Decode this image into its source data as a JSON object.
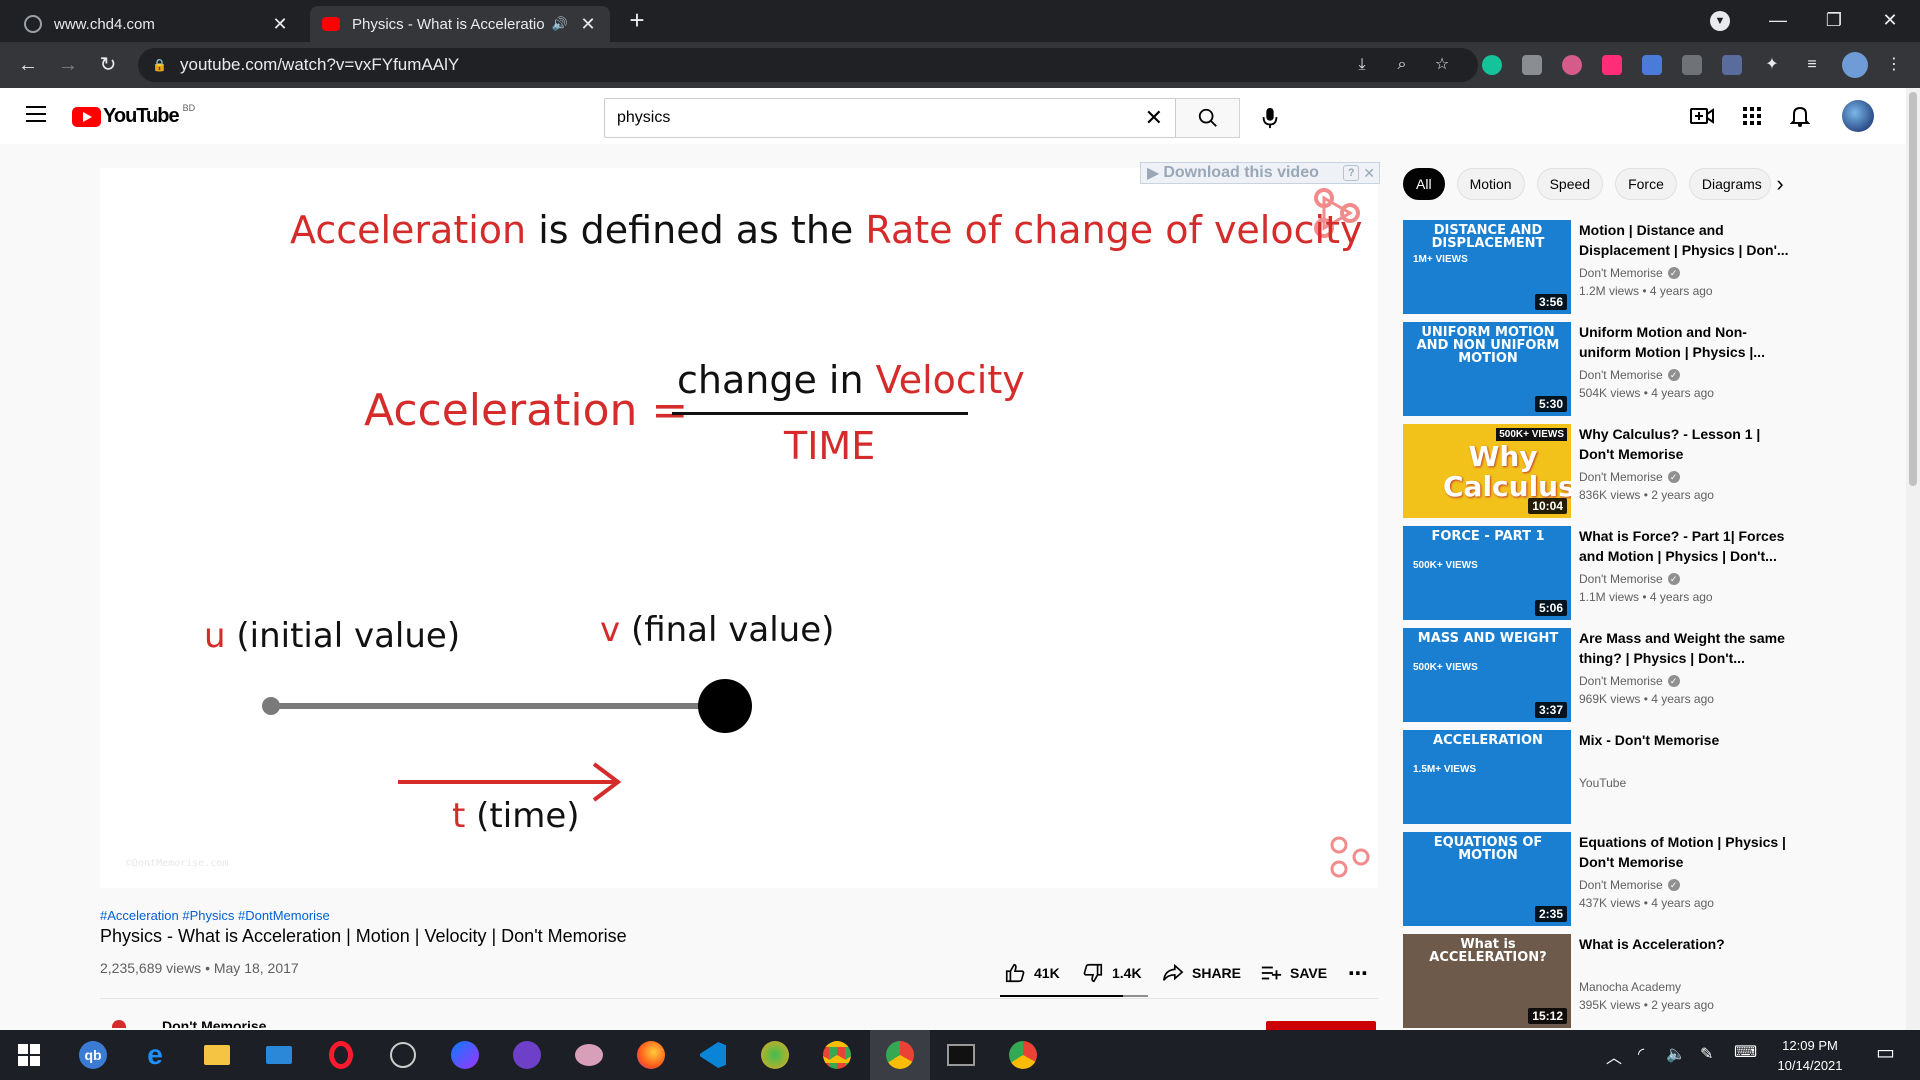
{
  "browser": {
    "tabs": [
      {
        "title": "www.chd4.com",
        "active": false
      },
      {
        "title": "Physics - What is Acceleratio",
        "active": true
      }
    ],
    "url": "youtube.com/watch?v=vxFYfumAAlY"
  },
  "youtube": {
    "logo_text": "YouTube",
    "country_code": "BD",
    "search_value": "physics"
  },
  "video": {
    "download_label": "Download this video",
    "download_help": "?",
    "slide": {
      "line1_red_a": "Acceleration",
      "line1_black": "is defined as the",
      "line1_red_b": "Rate of change of velocity",
      "formula_lhs": "Acceleration =",
      "numerator_black": "change in",
      "numerator_red": "Velocity",
      "denominator": "TIME",
      "u_letter": "u",
      "u_label": "(initial value)",
      "v_letter": "v",
      "v_label": "(final value)",
      "t_letter": "t",
      "t_label": "(time)",
      "watermark": "©DontMemorise.com"
    },
    "hashtags": "#Acceleration #Physics #DontMemorise",
    "title": "Physics - What is Acceleration | Motion | Velocity | Don't Memorise",
    "meta": "2,235,689 views • May 18, 2017",
    "likes": "41K",
    "dislikes": "1.4K",
    "like_ratio": 0.83,
    "share_label": "SHARE",
    "save_label": "SAVE",
    "more_label": "⋯",
    "channel_peek": "Don't Memorise"
  },
  "chips": [
    "All",
    "Motion",
    "Speed",
    "Force",
    "Diagrams"
  ],
  "recommendations": [
    {
      "thumb_title": "DISTANCE AND DISPLACEMENT",
      "thumb_views": "1M+ VIEWS",
      "duration": "3:56",
      "title": "Motion | Distance and Displacement | Physics | Don'...",
      "channel": "Don't Memorise",
      "verified": true,
      "meta": "1.2M views • 4 years ago",
      "color": "#1a7fd1"
    },
    {
      "thumb_title": "UNIFORM MOTION AND NON UNIFORM MOTION",
      "thumb_views": "",
      "duration": "5:30",
      "title": "Uniform Motion and Non-uniform Motion | Physics |...",
      "channel": "Don't Memorise",
      "verified": true,
      "meta": "504K views • 4 years ago",
      "color": "#1a7fd1"
    },
    {
      "thumb_title": "Why Calculus?",
      "thumb_views": "500K+ VIEWS",
      "duration": "10:04",
      "title": "Why Calculus? - Lesson 1 | Don't Memorise",
      "channel": "Don't Memorise",
      "verified": true,
      "meta": "836K views • 2 years ago",
      "color": "#f2c21b"
    },
    {
      "thumb_title": "FORCE - PART 1",
      "thumb_views": "500K+ VIEWS",
      "duration": "5:06",
      "title": "What is Force? - Part 1| Forces and Motion | Physics | Don't...",
      "channel": "Don't Memorise",
      "verified": true,
      "meta": "1.1M views • 4 years ago",
      "color": "#1a7fd1"
    },
    {
      "thumb_title": "MASS AND WEIGHT",
      "thumb_views": "500K+ VIEWS",
      "duration": "3:37",
      "title": "Are Mass and Weight the same thing? | Physics | Don't...",
      "channel": "Don't Memorise",
      "verified": true,
      "meta": "969K views • 4 years ago",
      "color": "#1a7fd1"
    },
    {
      "thumb_title": "ACCELERATION",
      "thumb_views": "1.5M+ VIEWS",
      "duration": "",
      "title": "Mix - Don't Memorise",
      "channel": "YouTube",
      "verified": false,
      "meta": "",
      "color": "#1a7fd1"
    },
    {
      "thumb_title": "EQUATIONS OF MOTION",
      "thumb_views": "",
      "duration": "2:35",
      "title": "Equations of Motion | Physics | Don't Memorise",
      "channel": "Don't Memorise",
      "verified": true,
      "meta": "437K views • 4 years ago",
      "color": "#1a7fd1"
    },
    {
      "thumb_title": "What is ACCELERATION?",
      "thumb_views": "",
      "duration": "15:12",
      "title": "What is Acceleration?",
      "channel": "Manocha Academy",
      "verified": false,
      "meta": "395K views • 2 years ago",
      "color": "#6e5a4a"
    }
  ],
  "taskbar": {
    "time": "12:09 PM",
    "date": "10/14/2021"
  }
}
